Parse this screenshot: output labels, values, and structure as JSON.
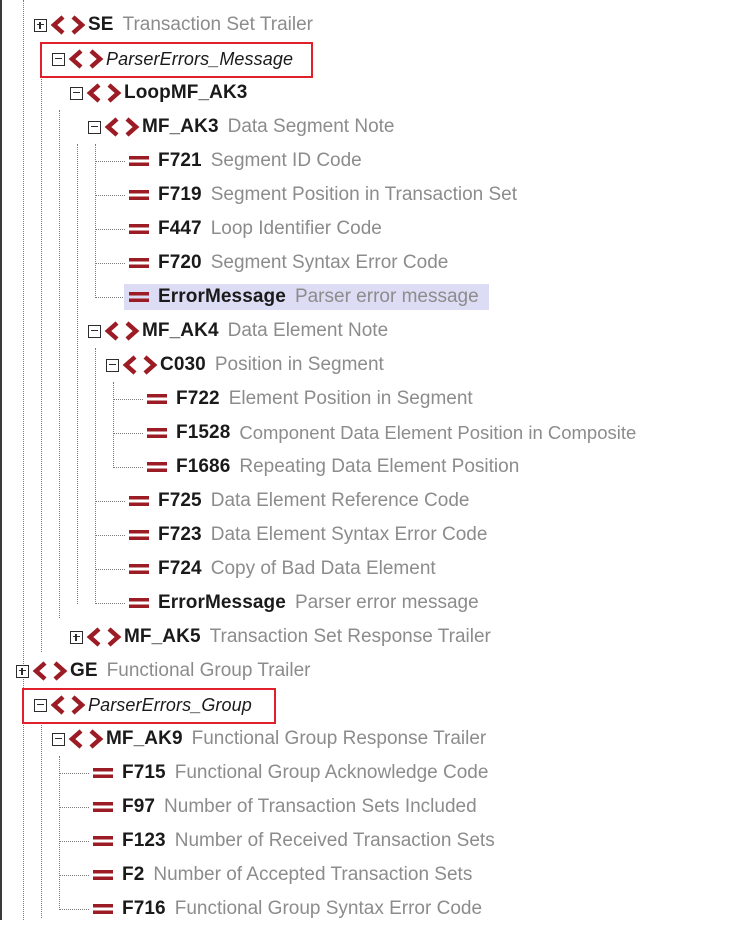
{
  "tree": {
    "rows": [
      {
        "name": "SE",
        "desc": "Transaction Set Trailer",
        "kind": "element",
        "toggle": "plus"
      },
      {
        "name": "ParserErrors_Message",
        "desc": "",
        "kind": "element",
        "toggle": "minus",
        "italic": true
      },
      {
        "name": "LoopMF_AK3",
        "desc": "",
        "kind": "element",
        "toggle": "minus"
      },
      {
        "name": "MF_AK3",
        "desc": "Data Segment Note",
        "kind": "element",
        "toggle": "minus"
      },
      {
        "name": "F721",
        "desc": "Segment ID Code",
        "kind": "attribute"
      },
      {
        "name": "F719",
        "desc": "Segment Position in Transaction Set",
        "kind": "attribute"
      },
      {
        "name": "F447",
        "desc": "Loop Identifier Code",
        "kind": "attribute"
      },
      {
        "name": "F720",
        "desc": "Segment Syntax Error Code",
        "kind": "attribute"
      },
      {
        "name": "ErrorMessage",
        "desc": "Parser error message",
        "kind": "attribute",
        "selected": true
      },
      {
        "name": "MF_AK4",
        "desc": "Data Element Note",
        "kind": "element",
        "toggle": "minus"
      },
      {
        "name": "C030",
        "desc": "Position in Segment",
        "kind": "element",
        "toggle": "minus"
      },
      {
        "name": "F722",
        "desc": "Element Position in Segment",
        "kind": "attribute"
      },
      {
        "name": "F1528",
        "desc": "Component Data Element Position in Composite",
        "kind": "attribute"
      },
      {
        "name": "F1686",
        "desc": "Repeating Data Element Position",
        "kind": "attribute"
      },
      {
        "name": "F725",
        "desc": "Data Element Reference Code",
        "kind": "attribute"
      },
      {
        "name": "F723",
        "desc": "Data Element Syntax Error Code",
        "kind": "attribute"
      },
      {
        "name": "F724",
        "desc": "Copy of Bad Data Element",
        "kind": "attribute"
      },
      {
        "name": "ErrorMessage",
        "desc": "Parser error message",
        "kind": "attribute"
      },
      {
        "name": "MF_AK5",
        "desc": "Transaction Set Response Trailer",
        "kind": "element",
        "toggle": "plus"
      },
      {
        "name": "GE",
        "desc": "Functional Group Trailer",
        "kind": "element",
        "toggle": "plus"
      },
      {
        "name": "ParserErrors_Group",
        "desc": "",
        "kind": "element",
        "toggle": "minus",
        "italic": true
      },
      {
        "name": "MF_AK9",
        "desc": "Functional Group Response Trailer",
        "kind": "element",
        "toggle": "minus"
      },
      {
        "name": "F715",
        "desc": "Functional Group Acknowledge Code",
        "kind": "attribute"
      },
      {
        "name": "F97",
        "desc": "Number of Transaction Sets Included",
        "kind": "attribute"
      },
      {
        "name": "F123",
        "desc": "Number of Received Transaction Sets",
        "kind": "attribute"
      },
      {
        "name": "F2",
        "desc": "Number of Accepted Transaction Sets",
        "kind": "attribute"
      },
      {
        "name": "F716",
        "desc": "Functional Group Syntax Error Code",
        "kind": "attribute"
      }
    ]
  },
  "colors": {
    "icon": "#9b1c24",
    "highlight_box": "#e0202a",
    "selection": "#dcdcf4",
    "description": "#8c8c8c"
  },
  "icons": {
    "element": "element-brackets-icon",
    "attribute": "attribute-equals-icon"
  }
}
